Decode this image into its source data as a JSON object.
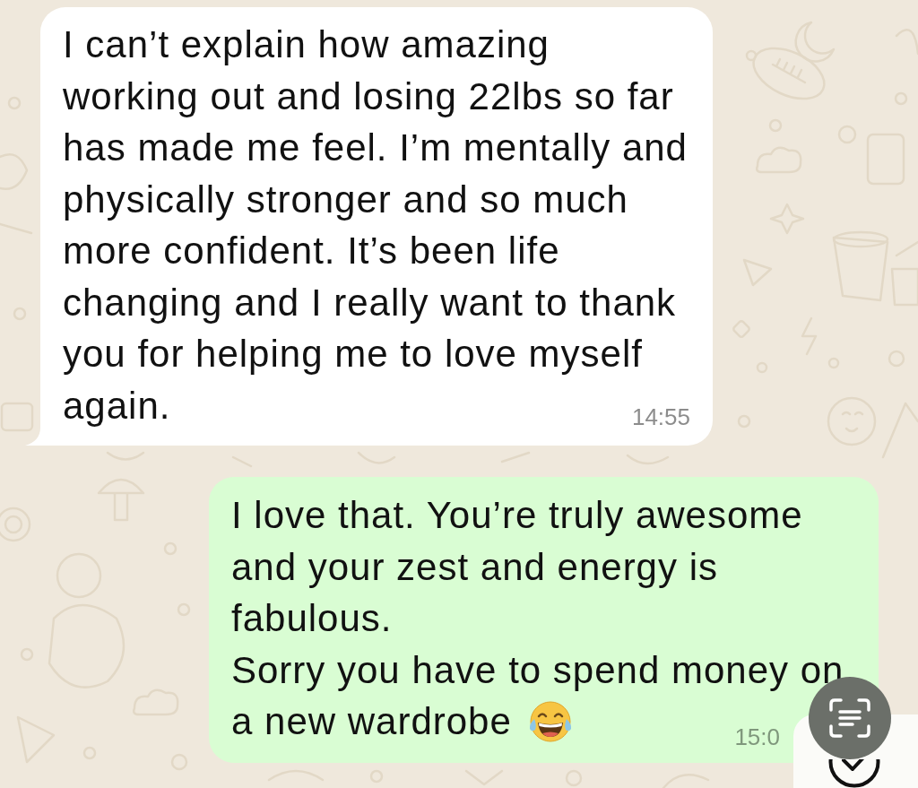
{
  "conversation": {
    "messages": [
      {
        "kind": "incoming",
        "lines": [
          "I can’t explain how amazing",
          "working out and losing 22lbs so far",
          "has made me feel. I’m mentally and",
          "physically stronger and so much",
          "more confident. It’s been life",
          "changing and I really want to thank",
          "you for helping me to love myself",
          "again."
        ],
        "ends_with_emoji": false,
        "time": "14:55"
      },
      {
        "kind": "outgoing",
        "lines": [
          "I love that. You’re truly awesome",
          "and your zest and energy is",
          "fabulous.",
          "Sorry you have to spend money on",
          "a new wardrobe"
        ],
        "ends_with_emoji": true,
        "time": "15:0"
      }
    ]
  }
}
